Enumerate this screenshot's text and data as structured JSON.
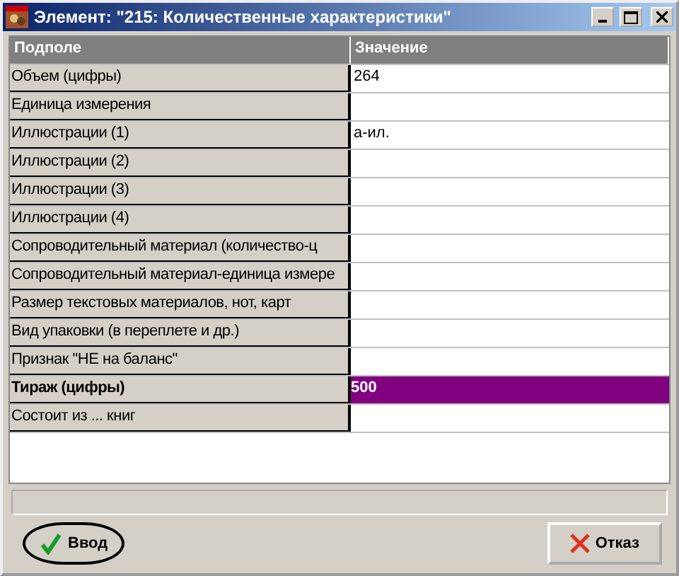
{
  "window": {
    "title": "Элемент: \"215: Количественные характеристики\""
  },
  "table": {
    "columns": [
      "Подполе",
      "Значение"
    ],
    "rows": [
      {
        "field": "Объем (цифры)",
        "value": "264",
        "selected": false
      },
      {
        "field": "Единица измерения",
        "value": "",
        "selected": false
      },
      {
        "field": "Иллюстрации (1)",
        "value": "а-ил.",
        "selected": false
      },
      {
        "field": "Иллюстрации (2)",
        "value": "",
        "selected": false
      },
      {
        "field": "Иллюстрации (3)",
        "value": "",
        "selected": false
      },
      {
        "field": "Иллюстрации (4)",
        "value": "",
        "selected": false
      },
      {
        "field": "Сопроводительный материал (количество-ц",
        "value": "",
        "selected": false
      },
      {
        "field": "Сопроводительный материал-единица измере",
        "value": "",
        "selected": false
      },
      {
        "field": "Размер текстовых материалов, нот, карт",
        "value": "",
        "selected": false
      },
      {
        "field": "Вид упаковки (в переплете и др.)",
        "value": "",
        "selected": false
      },
      {
        "field": "Признак \"НЕ на баланс\"",
        "value": "",
        "selected": false
      },
      {
        "field": "Тираж (цифры)",
        "value": "500",
        "selected": true
      },
      {
        "field": "Состоит из ... книг",
        "value": "",
        "selected": false
      }
    ]
  },
  "buttons": [
    {
      "label": "Ввод",
      "kind": "ok",
      "focused": true
    },
    {
      "label": "Отказ",
      "kind": "cancel",
      "focused": false
    }
  ]
}
